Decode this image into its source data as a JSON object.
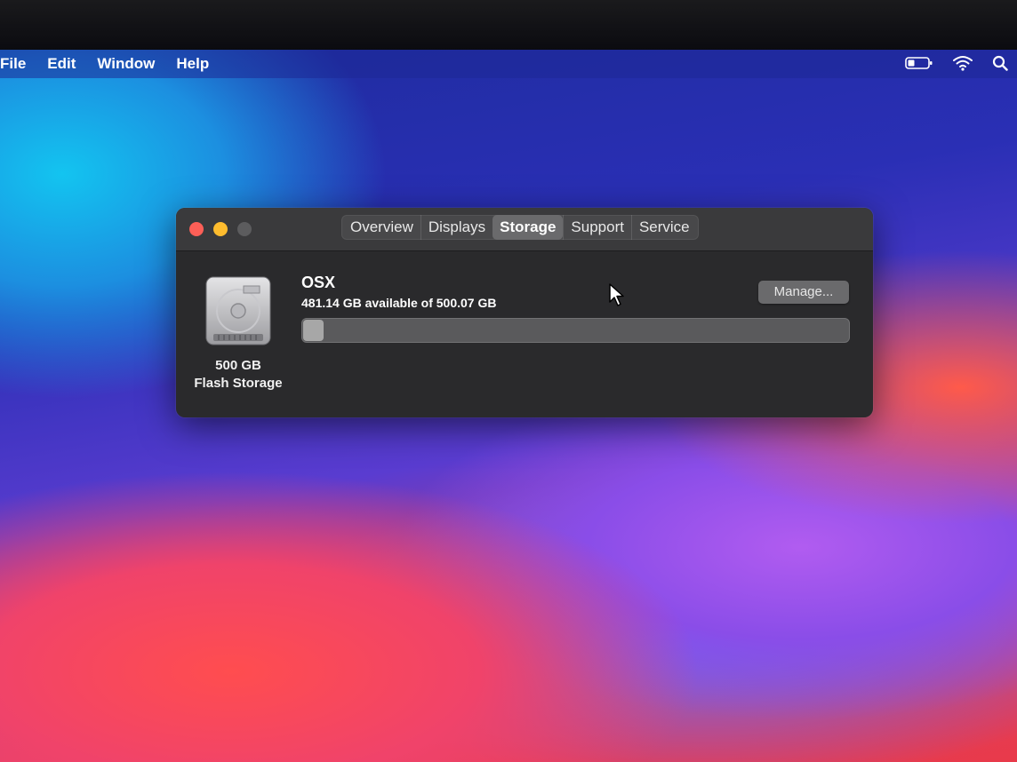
{
  "menubar": {
    "items": [
      {
        "label": "File"
      },
      {
        "label": "Edit"
      },
      {
        "label": "Window"
      },
      {
        "label": "Help"
      }
    ],
    "status_icons": [
      "battery-icon",
      "wifi-icon",
      "search-icon"
    ]
  },
  "window": {
    "tabs": [
      {
        "label": "Overview"
      },
      {
        "label": "Displays"
      },
      {
        "label": "Storage",
        "active": true
      },
      {
        "label": "Support"
      },
      {
        "label": "Service"
      }
    ],
    "storage": {
      "disk_size": "500 GB",
      "disk_type": "Flash Storage",
      "volume_name": "OSX",
      "usage_text": "481.14 GB available of 500.07 GB",
      "used_fraction": 0.038,
      "manage_label": "Manage..."
    }
  },
  "colors": {
    "close": "#fd5f57",
    "minimize": "#febc2e",
    "window_bg": "#2a2a2c"
  }
}
